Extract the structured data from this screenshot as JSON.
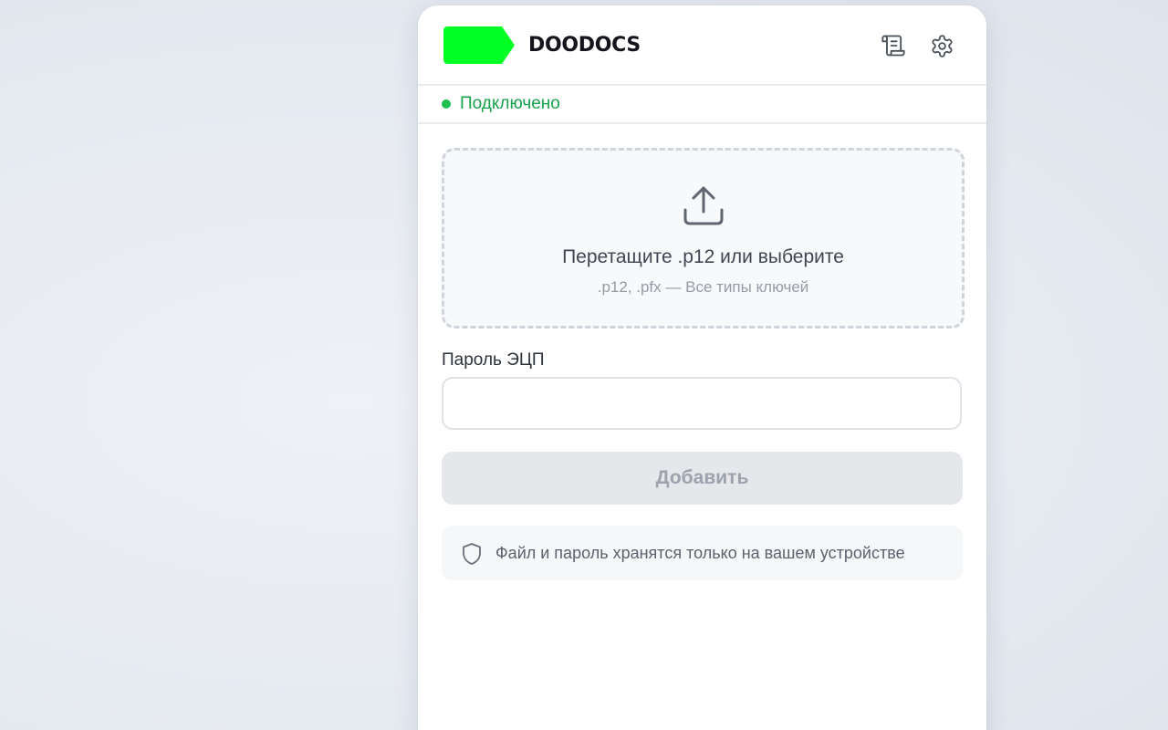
{
  "brand": {
    "name": "DOODOCS",
    "logo_color": "#00FF22"
  },
  "header": {
    "docs_icon": "scroll-document-icon",
    "settings_icon": "gear-icon"
  },
  "status": {
    "text": "Подключено",
    "color": "#16A34A"
  },
  "dropzone": {
    "icon": "upload-icon",
    "title": "Перетащите .p12 или выберите",
    "subtitle": ".p12, .pfx — Все типы ключей"
  },
  "password": {
    "label": "Пароль ЭЦП",
    "value": "",
    "placeholder": ""
  },
  "add_button": {
    "label": "Добавить",
    "disabled": true
  },
  "note": {
    "icon": "shield-icon",
    "text": "Файл и пароль хранятся только на вашем устройстве"
  }
}
